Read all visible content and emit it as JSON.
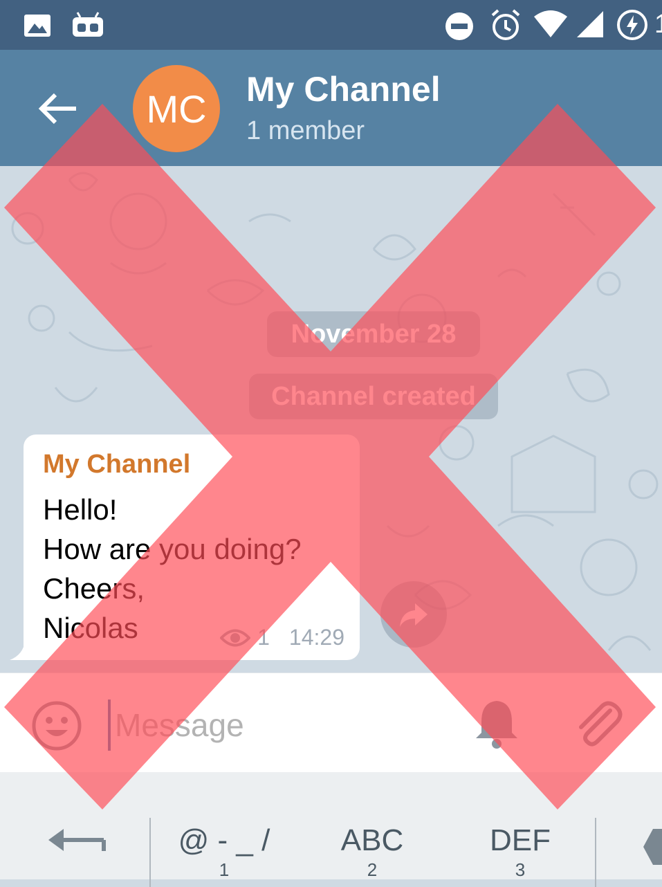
{
  "statusbar": {
    "icons": [
      "image-icon",
      "android-icon",
      "do-not-disturb-icon",
      "alarm-icon",
      "wifi-icon",
      "signal-icon",
      "battery-charging-icon"
    ],
    "partial_text": "1"
  },
  "header": {
    "avatar_initials": "MC",
    "title": "My Channel",
    "subtitle": "1 member",
    "back_icon": "back-arrow-icon"
  },
  "chat": {
    "date_label": "November 28",
    "service_message": "Channel created",
    "messages": [
      {
        "author": "My Channel",
        "text": "Hello!\nHow are you doing?\nCheers,\nNicolas",
        "views": "1",
        "time": "14:29"
      }
    ]
  },
  "input": {
    "placeholder": "Message",
    "emoji_icon": "smiley-icon",
    "bell_icon": "bell-icon",
    "attach_icon": "paperclip-icon"
  },
  "keyboard": {
    "keys": [
      {
        "main": "@ - _ /",
        "sub": "1"
      },
      {
        "main": "ABC",
        "sub": "2"
      },
      {
        "main": "DEF",
        "sub": "3"
      }
    ]
  },
  "colors": {
    "statusbar": "#426181",
    "toolbar": "#5682a3",
    "avatar": "#f28c48",
    "author": "#d2782c",
    "overlay_x": "#ff4d57"
  }
}
